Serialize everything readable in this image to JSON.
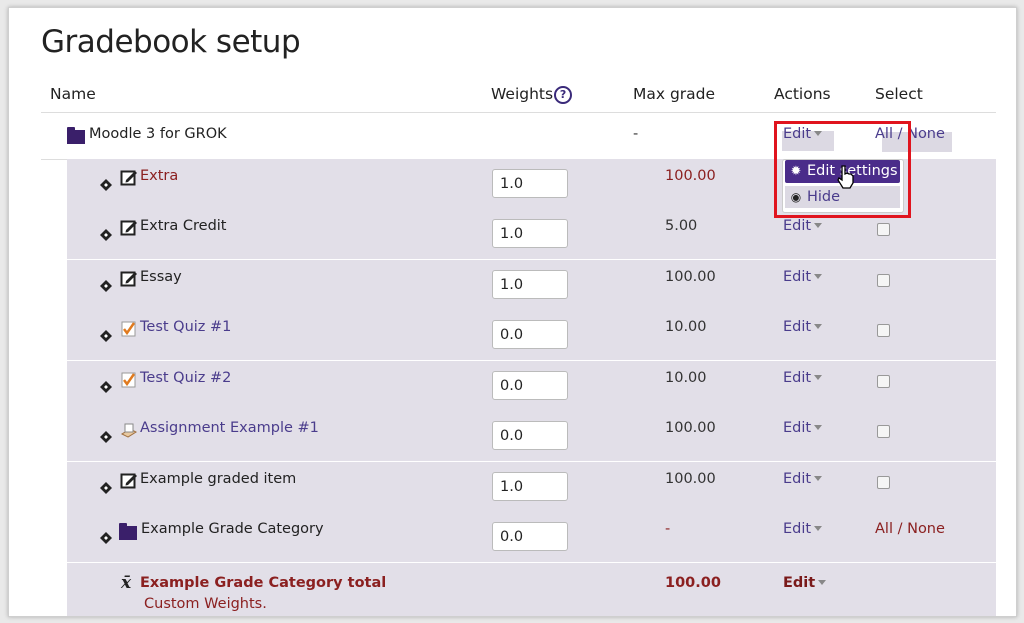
{
  "title": "Gradebook setup",
  "headers": {
    "name": "Name",
    "weights": "Weights",
    "max_grade": "Max grade",
    "actions": "Actions",
    "select": "Select"
  },
  "course": {
    "name": "Moodle 3 for GROK",
    "max": "-",
    "edit": "Edit",
    "all": "All",
    "sep": " / ",
    "none": "None"
  },
  "menu": {
    "edit_settings": "Edit settings",
    "hide": "Hide"
  },
  "items": [
    {
      "name": "Extra",
      "weight": "1.0",
      "max": "100.00",
      "edit": "Edit",
      "style": "red"
    },
    {
      "name": "Extra Credit",
      "weight": "1.0",
      "max": "5.00",
      "edit": "Edit",
      "style": "dark"
    },
    {
      "name": "Essay",
      "weight": "1.0",
      "max": "100.00",
      "edit": "Edit",
      "style": "dark"
    },
    {
      "name": "Test Quiz #1",
      "weight": "0.0",
      "max": "10.00",
      "edit": "Edit",
      "style": "link"
    },
    {
      "name": "Test Quiz #2",
      "weight": "0.0",
      "max": "10.00",
      "edit": "Edit",
      "style": "link"
    },
    {
      "name": "Assignment Example #1",
      "weight": "0.0",
      "max": "100.00",
      "edit": "Edit",
      "style": "link"
    },
    {
      "name": "Example graded item",
      "weight": "1.0",
      "max": "100.00",
      "edit": "Edit",
      "style": "dark"
    }
  ],
  "category": {
    "name": "Example Grade Category",
    "weight": "0.0",
    "max": "-",
    "edit": "Edit",
    "all": "All",
    "sep": " / ",
    "none": "None"
  },
  "total": {
    "name": "Example Grade Category total",
    "note": "Custom Weights.",
    "max": "100.00",
    "edit": "Edit"
  },
  "colors": {
    "accent": "#4a2c8a",
    "row": "#e2dfe8",
    "highlight": "#e0141e"
  }
}
